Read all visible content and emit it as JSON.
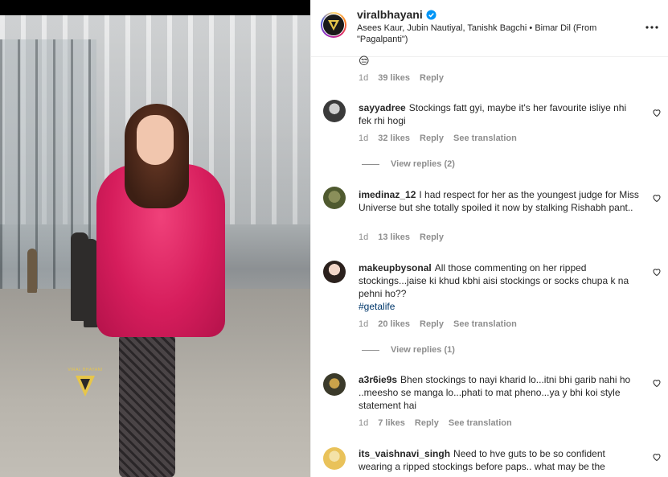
{
  "post": {
    "username": "viralbhayani",
    "audio": "Asees Kaur, Jubin Nautiyal, Tanishk Bagchi • Bimar Dil (From \"Pagalpanti\")",
    "watermark": "VIRAL BHAYANI"
  },
  "first_comment_meta": {
    "time": "1d",
    "likes": "39 likes",
    "reply": "Reply"
  },
  "comments": [
    {
      "username": "sayyadree",
      "text": "Stockings fatt gyi, maybe it's her favourite isliye nhi fek rhi hogi",
      "time": "1d",
      "likes": "32 likes",
      "reply": "Reply",
      "translate": "See translation",
      "replies": "View replies (2)"
    },
    {
      "username": "imedinaz_12",
      "text": "I had respect for her as the youngest judge for Miss Universe but she totally spoiled it now by stalking Rishabh pant..",
      "time": "1d",
      "likes": "13 likes",
      "reply": "Reply"
    },
    {
      "username": "makeupbysonal",
      "text": "All those commenting on her ripped stockings...jaise ki khud kbhi aisi stockings or socks chupa k na pehni ho??",
      "hashtag": "#getalife",
      "time": "1d",
      "likes": "20 likes",
      "reply": "Reply",
      "translate": "See translation",
      "replies": "View replies (1)"
    },
    {
      "username": "a3r6ie9s",
      "text": "Bhen stockings to nayi kharid lo...itni bhi garib nahi ho ..meesho se manga lo...phati to mat pheno...ya y bhi koi style statement hai",
      "time": "1d",
      "likes": "7 likes",
      "reply": "Reply",
      "translate": "See translation"
    },
    {
      "username": "its_vaishnavi_singh",
      "text": "Need to hve guts to be so confident wearing a ripped stockings before paps.. what may be the"
    }
  ],
  "colors": {
    "verified": "#0095f6",
    "hashtag": "#00376b",
    "dress": "#d61d5c",
    "watermark": "#e7c64a"
  }
}
